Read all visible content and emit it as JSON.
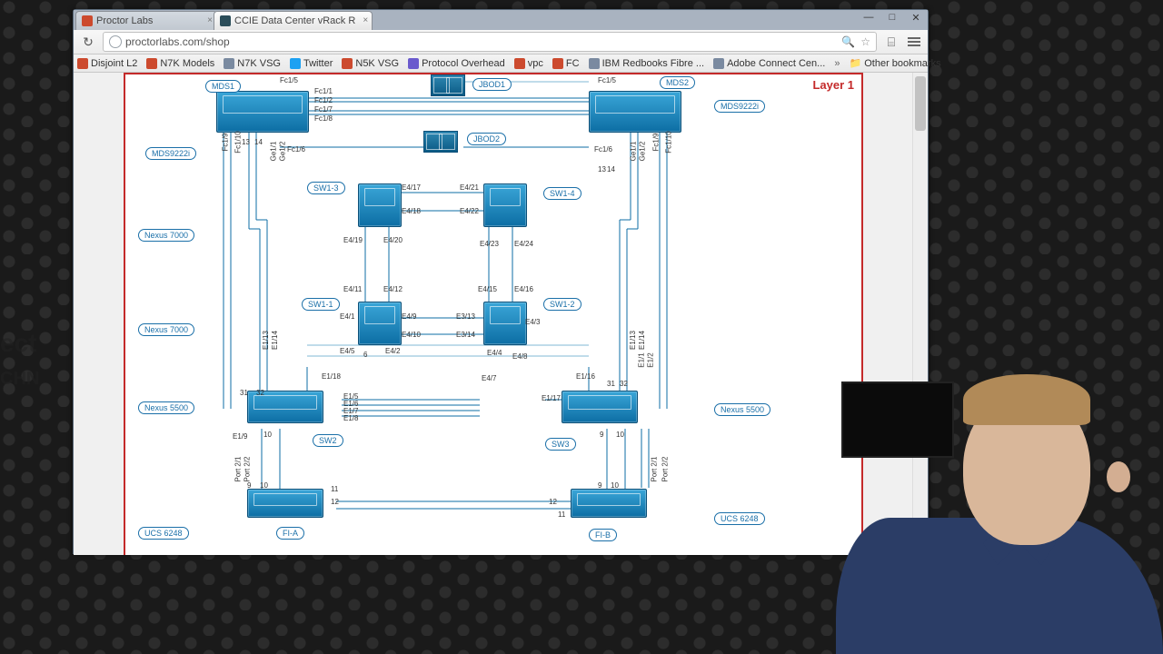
{
  "tabs": [
    {
      "title": "Proctor Labs"
    },
    {
      "title": "CCIE Data Center vRack R"
    }
  ],
  "window_buttons": {
    "min": "—",
    "max": "□",
    "close": "✕"
  },
  "toolbar": {
    "reload": "↻",
    "url": "proctorlabs.com/shop",
    "search": "🔍",
    "star": "☆",
    "cast": "⌸"
  },
  "bookmarks": [
    {
      "label": "Disjoint L2"
    },
    {
      "label": "N7K Models"
    },
    {
      "label": "N7K VSG"
    },
    {
      "label": "Twitter"
    },
    {
      "label": "N5K VSG"
    },
    {
      "label": "Protocol Overhead"
    },
    {
      "label": "vpc"
    },
    {
      "label": "FC"
    },
    {
      "label": "IBM Redbooks Fibre ..."
    },
    {
      "label": "Adobe Connect Cen..."
    }
  ],
  "bookmarks_overflow": "»",
  "other_bookmarks": "Other bookmarks",
  "ghost_text": {
    "line1": "ect",
    "line2": "CHN"
  },
  "diagram": {
    "watermark": "Layer 1",
    "legend_left": [
      "MDS9222i",
      "Nexus 7000",
      "Nexus 7000",
      "Nexus 5500",
      "UCS 6248"
    ],
    "legend_right": [
      "MDS9222i",
      "Nexus 5500",
      "UCS 6248"
    ],
    "device_chips": [
      "MDS1",
      "MDS2",
      "JBOD1",
      "JBOD2",
      "SW1-3",
      "SW1-4",
      "SW1-1",
      "SW1-2",
      "SW2",
      "SW3",
      "FI-A",
      "FI-B"
    ],
    "port_labels_top": [
      "Fc1/5",
      "Fc1/1",
      "Fc1/2",
      "Fc1/7",
      "Fc1/8",
      "Fc1/6"
    ],
    "port_labels_fc_right": [
      "Fc1/5",
      "Fc1/6"
    ],
    "port_labels_side_left": [
      "Fc1/9",
      "Fc1/10",
      "Ge1/1",
      "Ge1/2"
    ],
    "port_labels_side_right": [
      "Ge1/1",
      "Ge1/2",
      "Fc1/9",
      "Fc1/10"
    ],
    "nums_mds_left": [
      "13",
      "14"
    ],
    "nums_mds_right": [
      "13",
      "14"
    ],
    "port_labels_e4_upper": [
      "E4/17",
      "E4/18",
      "E4/19",
      "E4/20",
      "E4/21",
      "E4/22",
      "E4/23",
      "E4/24"
    ],
    "port_labels_e4_mid": [
      "E4/11",
      "E4/12",
      "E4/15",
      "E4/16",
      "E4/1",
      "E4/9",
      "E3/13",
      "E4/3",
      "E4/5",
      "E4/2",
      "E4/10",
      "E3/14",
      "E4/4",
      "E4/8",
      "6"
    ],
    "port_labels_e1": [
      "E1/13",
      "E1/14",
      "E1/18",
      "E4/7",
      "E1/16",
      "E1/5",
      "E1/6",
      "E1/7",
      "E1/8",
      "E1/17",
      "E1/9",
      "E1/13",
      "E1/14"
    ],
    "port_labels_right_mid": [
      "E1/1",
      "E1/2"
    ],
    "nums_lower_left": [
      "31",
      "32",
      "10"
    ],
    "nums_lower_right": [
      "31",
      "32",
      "9",
      "10"
    ],
    "nums_bottom_left": [
      "9",
      "10",
      "11",
      "12"
    ],
    "nums_bottom_right": [
      "9",
      "10",
      "11",
      "12"
    ],
    "port_labels_bottom": [
      "Port 2/1",
      "Port 2/2",
      "Port 2/1",
      "Port 2/2"
    ]
  }
}
